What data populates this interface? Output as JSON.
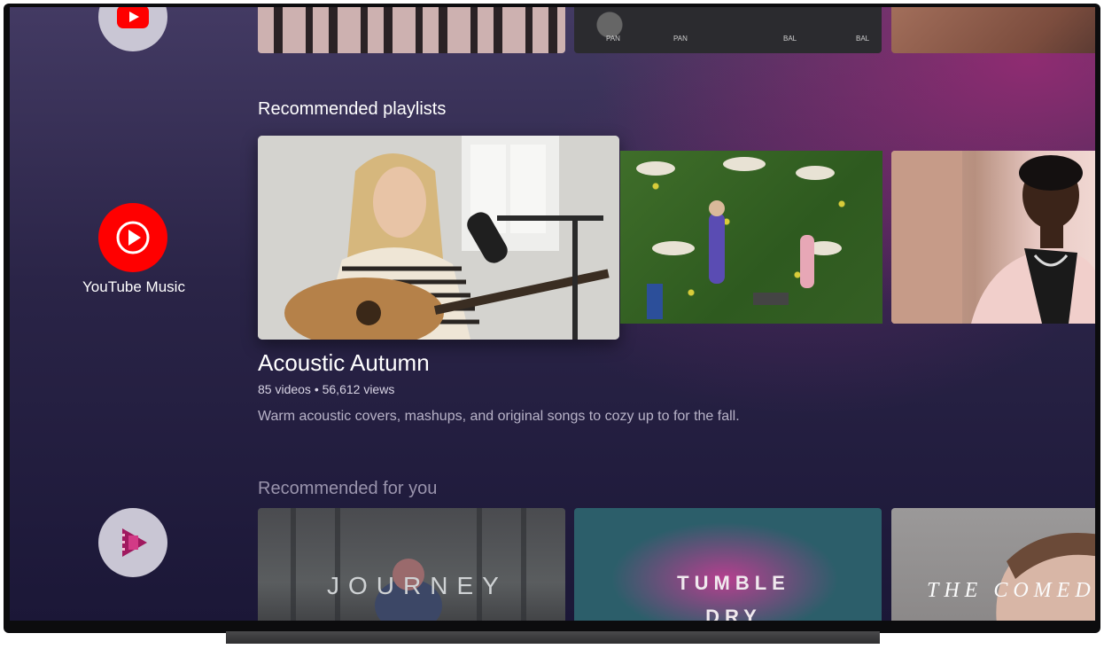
{
  "sidebar": {
    "apps": [
      {
        "name": "YouTube",
        "icon": "youtube-icon"
      },
      {
        "name": "YouTube Music",
        "icon": "youtube-music-icon",
        "label": "YouTube Music"
      },
      {
        "name": "Google Play Movies",
        "icon": "play-movies-icon"
      }
    ]
  },
  "top_row": {
    "mixer_labels": [
      "PAN",
      "PAN",
      "BAL",
      "BAL"
    ]
  },
  "playlists": {
    "section_title": "Recommended playlists",
    "featured": {
      "title": "Acoustic Autumn",
      "meta": "85 videos • 56,612 views",
      "description": "Warm acoustic covers, mashups, and original songs to cozy up to for the fall."
    }
  },
  "recommended": {
    "section_title": "Recommended for you",
    "items": [
      {
        "poster_text": "JOURNEY"
      },
      {
        "poster_text": "TUMBLE DRY"
      },
      {
        "poster_text": "THE COMEDY"
      }
    ]
  },
  "colors": {
    "youtube_red": "#ff0000",
    "movies_magenta": "#a0195f",
    "background_top": "#433a63",
    "background_bottom": "#1b1737"
  }
}
